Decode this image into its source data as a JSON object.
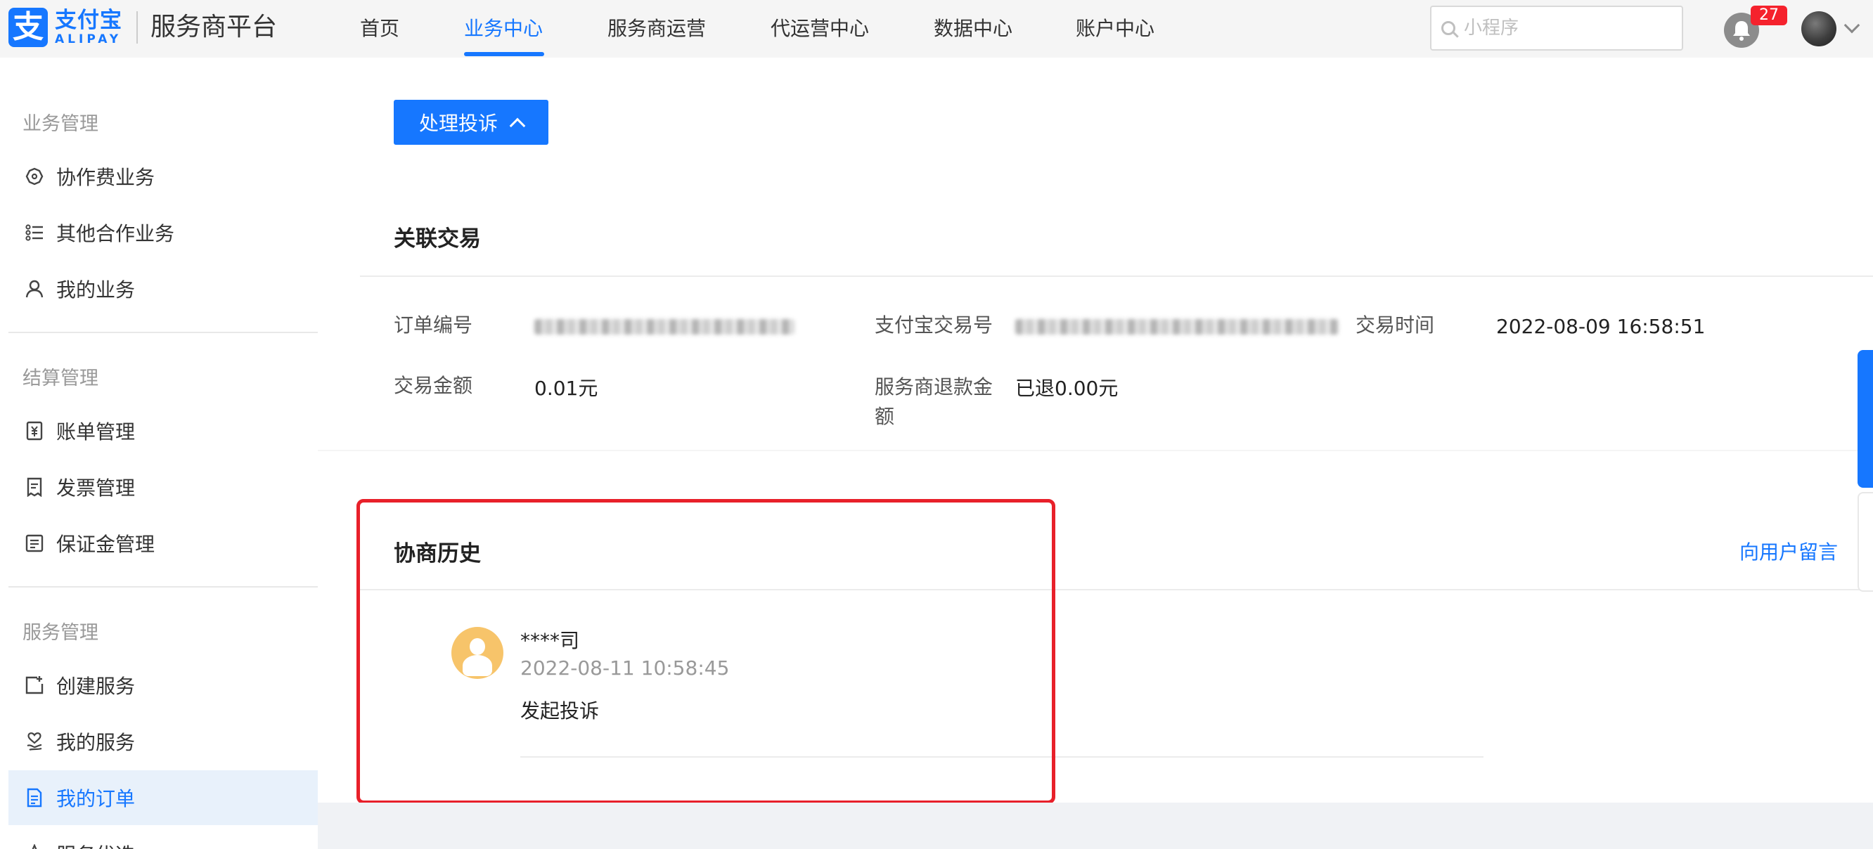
{
  "header": {
    "logo_mark": "支",
    "logo_cn": "支付宝",
    "logo_en": "ALIPAY",
    "platform_title": "服务商平台",
    "nav": [
      {
        "label": "首页"
      },
      {
        "label": "业务中心",
        "active": true
      },
      {
        "label": "服务商运营"
      },
      {
        "label": "代运营中心"
      },
      {
        "label": "数据中心"
      },
      {
        "label": "账户中心"
      }
    ],
    "search_placeholder": "小程序",
    "notification_count": "27",
    "accent_color": "#1677ff"
  },
  "sidebar": {
    "groups": [
      {
        "title": "业务管理",
        "items": [
          "协作费业务",
          "其他合作业务",
          "我的业务"
        ]
      },
      {
        "title": "结算管理",
        "items": [
          "账单管理",
          "发票管理",
          "保证金管理"
        ]
      },
      {
        "title": "服务管理",
        "items": [
          "创建服务",
          "我的服务",
          "我的订单",
          "服务优选"
        ]
      }
    ],
    "active_item": "我的订单"
  },
  "main": {
    "handle_complaint_button": "处理投诉",
    "related_trade": {
      "title": "关联交易",
      "order_no_label": "订单编号",
      "alipay_trade_no_label": "支付宝交易号",
      "trade_time_label": "交易时间",
      "trade_time": "2022-08-09 16:58:51",
      "amount_label": "交易金额",
      "amount": "0.01元",
      "refund_label": "服务商退款金额",
      "refund": "已退0.00元"
    },
    "history": {
      "title": "协商历史",
      "leave_message_link": "向用户留言",
      "entries": [
        {
          "name": "****司",
          "time": "2022-08-11 10:58:45",
          "action": "发起投诉"
        }
      ]
    }
  }
}
